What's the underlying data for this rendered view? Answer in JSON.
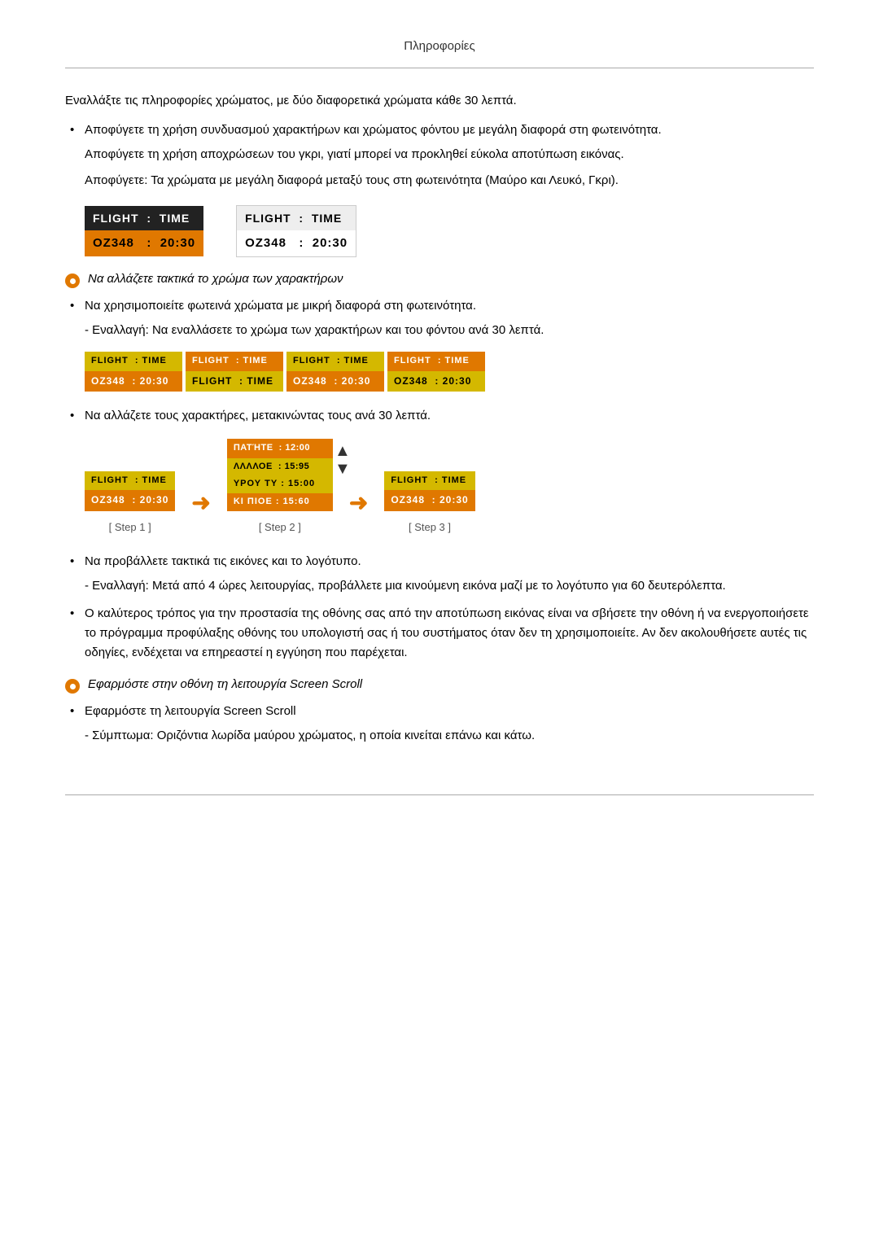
{
  "page": {
    "title": "Πληροφορίες",
    "intro": "Εναλλάξτε τις πληροφορίες χρώματος, με δύο διαφορετικά χρώματα κάθε 30 λεπτά.",
    "bullet1": "Αποφύγετε τη χρήση συνδυασμού χαρακτήρων και χρώματος φόντου με μεγάλη διαφορά στη φωτεινότητα.",
    "sub1": "Αποφύγετε τη χρήση αποχρώσεων του γκρι, γιατί μπορεί να προκληθεί εύκολα αποτύπωση εικόνας.",
    "sub2": "Αποφύγετε: Τα χρώματα με μεγάλη διαφορά μεταξύ τους στη φωτεινότητα (Μαύρο και Λευκό, Γκρι).",
    "orange_section1_label": "Να αλλάζετε τακτικά το χρώμα των χαρακτήρων",
    "bullet2": "Να χρησιμοποιείτε φωτεινά χρώματα με μικρή διαφορά στη φωτεινότητα.",
    "bullet2_sub": "- Εναλλαγή: Να εναλλάσετε το χρώμα των χαρακτήρων και του φόντου ανά 30 λεπτά.",
    "bullet3": "Να αλλάζετε τους χαρακτήρες, μετακινώντας τους ανά 30 λεπτά.",
    "bullet4": "Να προβάλλετε τακτικά τις εικόνες και το λογότυπο.",
    "bullet4_sub": "- Εναλλαγή: Μετά από 4 ώρες λειτουργίας, προβάλλετε μια κινούμενη εικόνα μαζί με το λογότυπο για 60 δευτερόλεπτα.",
    "bullet5_1": "Ο καλύτερος τρόπος για την προστασία της οθόνης σας από την αποτύπωση εικόνας είναι να σβήσετε την οθόνη ή να ενεργοποιήσετε το πρόγραμμα προφύλαξης οθόνης του υπολογιστή σας ή του συστήματος όταν δεν τη χρησιμοποιείτε. Αν δεν ακολουθήσετε αυτές τις οδηγίες, ενδέχεται να επηρεαστεί η εγγύηση που παρέχεται.",
    "orange_section2_label": "Εφαρμόστε στην οθόνη τη λειτουργία Screen Scroll",
    "bullet6": "Εφαρμόστε τη λειτουργία Screen Scroll",
    "bullet6_sub": "- Σύμπτωμα: Οριζόντια λωρίδα μαύρου χρώματος, η οποία κινείται επάνω και κάτω.",
    "flight_label": "FLIGHT  :  TIME",
    "flight_data_dark": "OZ348   :  20:30",
    "flight_data_light": "OZ348   :  20:30",
    "step1_label": "[ Step 1 ]",
    "step2_label": "[ Step 2 ]",
    "step3_label": "[ Step 3 ]",
    "step2_line1": "ΠΑΤΉΤΕ : 12:00",
    "step2_line1b": "ΛΛΛΛΟΕ : 15:95",
    "step2_line2": "ΥΡΟΥ ΤΥ : 15:00",
    "step2_line2b": "ΚΙ ΠΙΟΕ : 15:60"
  }
}
